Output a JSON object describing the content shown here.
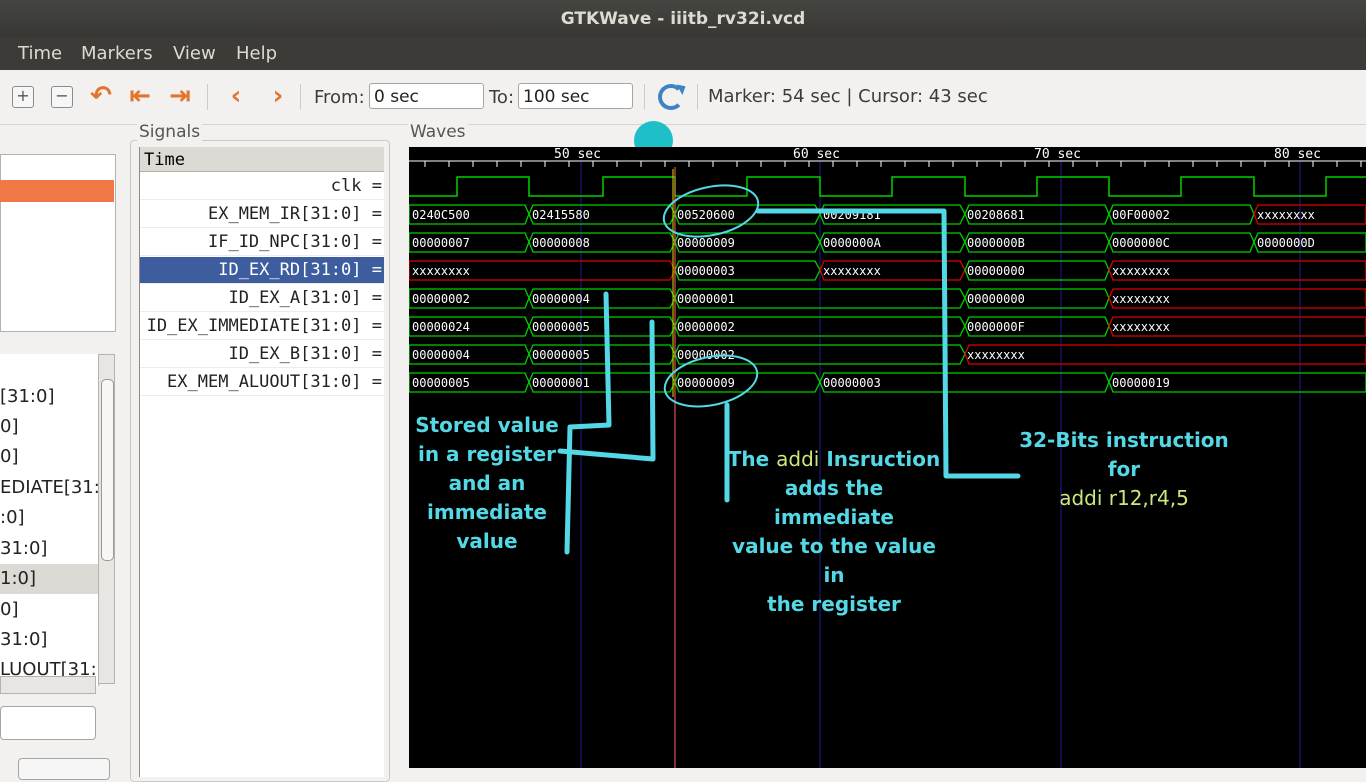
{
  "window": {
    "title": "GTKWave - iiitb_rv32i.vcd"
  },
  "menu": {
    "items": [
      "Time",
      "Markers",
      "View",
      "Help"
    ]
  },
  "toolbar": {
    "from_label": "From:",
    "from_value": "0 sec",
    "to_label": "To:",
    "to_value": "100 sec",
    "marker_text": "Marker: 54 sec  |  Cursor: 43 sec",
    "icons": [
      "zoom-in-icon",
      "zoom-out-icon",
      "undo-icon",
      "zoom-start-icon",
      "zoom-end-icon",
      "prev-icon",
      "next-icon",
      "reload-icon"
    ]
  },
  "sst": {
    "tree_selected": "",
    "list_items": [
      "[31:0]",
      "0]",
      "0]",
      "EDIATE[31:0",
      ":0]",
      "31:0]",
      "1:0]",
      "0]",
      "31:0]",
      "LUOUT[31:"
    ],
    "selected_index": 6
  },
  "signals": {
    "panel_label": "Signals",
    "header": "Time",
    "rows": [
      {
        "name": "clk",
        "sel": false
      },
      {
        "name": "EX_MEM_IR[31:0]",
        "sel": false
      },
      {
        "name": "IF_ID_NPC[31:0]",
        "sel": false
      },
      {
        "name": "ID_EX_RD[31:0]",
        "sel": true
      },
      {
        "name": "ID_EX_A[31:0]",
        "sel": false
      },
      {
        "name": "ID_EX_IMMEDIATE[31:0]",
        "sel": false
      },
      {
        "name": "ID_EX_B[31:0]",
        "sel": false
      },
      {
        "name": "EX_MEM_ALUOUT[31:0]",
        "sel": false
      }
    ]
  },
  "waves": {
    "panel_label": "Waves",
    "time_labels": [
      "50 sec",
      "60 sec",
      "70 sec",
      "80 sec"
    ],
    "ex_mem_ir": [
      "0240C500",
      "02415580",
      "00520600",
      "00209181",
      "00208681",
      "00F00002",
      "xxxxxxxx"
    ],
    "if_id_npc": [
      "00000007",
      "00000008",
      "00000009",
      "0000000A",
      "0000000B",
      "0000000C",
      "0000000D"
    ],
    "id_ex_rd": [
      "xxxxxxxx",
      "00000003",
      "xxxxxxxx",
      "00000000",
      "xxxxxxxx"
    ],
    "id_ex_a": [
      "00000002",
      "00000004",
      "00000001",
      "00000000",
      "xxxxxxxx"
    ],
    "id_ex_immediate": [
      "00000024",
      "00000005",
      "00000002",
      "0000000F",
      "xxxxxxxx"
    ],
    "id_ex_b": [
      "00000004",
      "00000005",
      "00000002",
      "xxxxxxxx"
    ],
    "ex_mem_aluout": [
      "00000005",
      "00000001",
      "00000009",
      "00000003",
      "00000019"
    ],
    "colors": {
      "valid": "#00d000",
      "undefined": "#e00000",
      "cursor": "#ff6060",
      "marker": "#e0e000",
      "grid": "#1a1a8a"
    }
  },
  "annotations": {
    "stored": [
      "Stored value",
      "in a  register",
      "and an",
      "immediate",
      "value"
    ],
    "addi_line1_pre": "The ",
    "addi_line1_hl": "addi",
    "addi_line1_post": " Insruction",
    "addi_rest": [
      "adds the immediate",
      "value to the value in",
      "the register"
    ],
    "bits": [
      "32-Bits instruction",
      "for"
    ],
    "bits_hl": "addi r12,r4,5"
  }
}
